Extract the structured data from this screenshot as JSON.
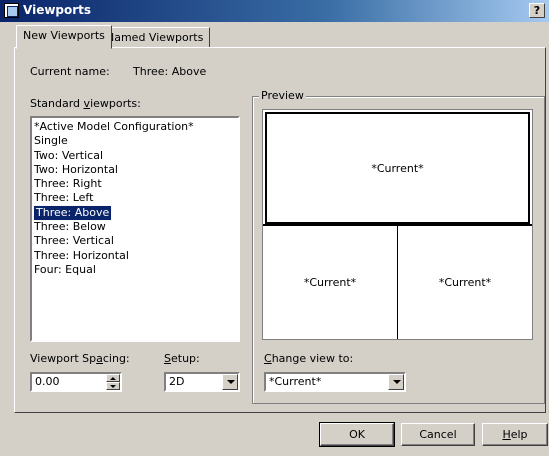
{
  "window": {
    "title": "Viewports",
    "help_glyph": "?"
  },
  "tabs": [
    {
      "label": "New Viewports",
      "active": true
    },
    {
      "label": "Named Viewports",
      "active": false
    }
  ],
  "current_name": {
    "label": "Current name:",
    "value": "Three: Above"
  },
  "standard_viewports": {
    "label_pre": "Standard ",
    "label_ul": "v",
    "label_post": "iewports:",
    "items": [
      "*Active Model Configuration*",
      "Single",
      "Two:  Vertical",
      "Two:  Horizontal",
      "Three: Right",
      "Three: Left",
      "Three: Above",
      "Three: Below",
      "Three: Vertical",
      "Three: Horizontal",
      "Four:  Equal"
    ],
    "selected": "Three: Above"
  },
  "preview": {
    "label": "Preview",
    "viewports": [
      "*Current*",
      "*Current*",
      "*Current*"
    ]
  },
  "viewport_spacing": {
    "label_pre": "Viewport Sp",
    "label_ul": "a",
    "label_post": "cing:",
    "value": "0.00"
  },
  "setup": {
    "label_pre": "",
    "label_ul": "S",
    "label_post": "etup:",
    "value": "2D"
  },
  "change_view": {
    "label_pre": "",
    "label_ul": "C",
    "label_post": "hange view to:",
    "value": "*Current*"
  },
  "buttons": {
    "ok": "OK",
    "cancel": "Cancel",
    "help_pre": "",
    "help_ul": "H",
    "help_post": "elp"
  }
}
